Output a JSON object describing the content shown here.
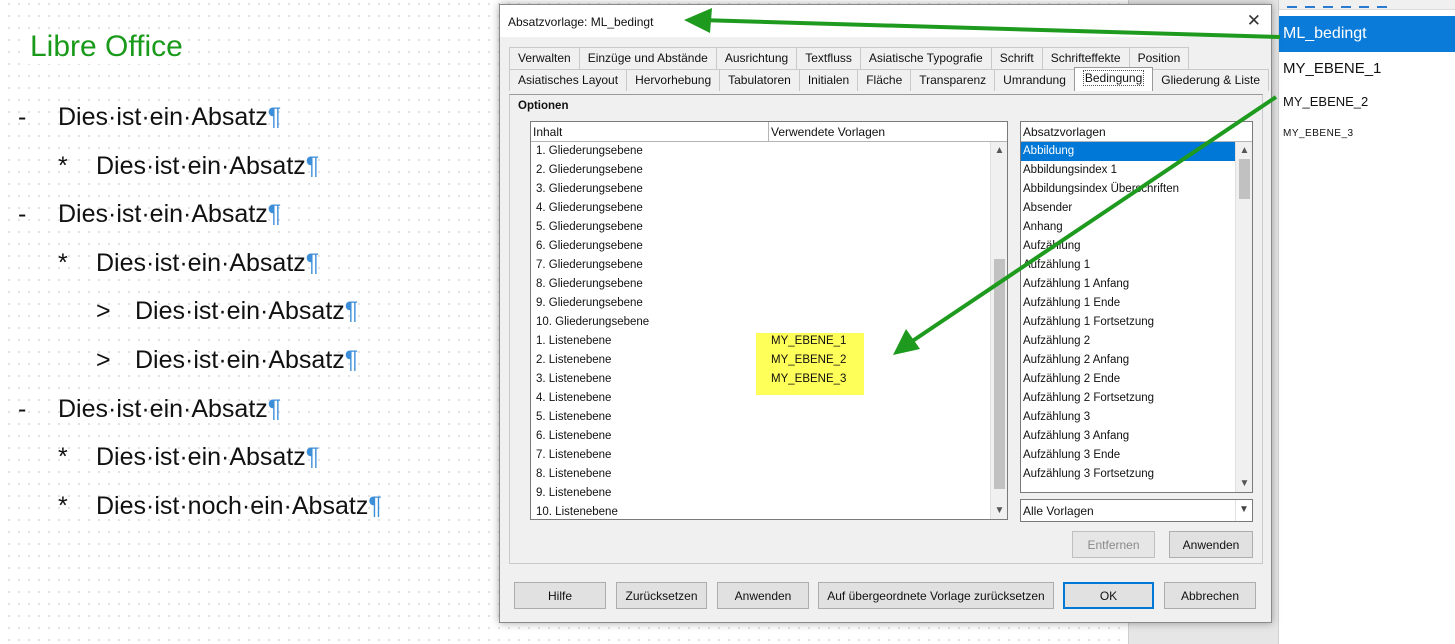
{
  "document": {
    "title": "Libre Office",
    "lines": [
      {
        "marker": "-",
        "text": "Dies·ist·ein·Absatz",
        "pilcrow": "¶"
      },
      {
        "marker": "*",
        "text": "Dies·ist·ein·Absatz",
        "pilcrow": "¶"
      },
      {
        "marker": "-",
        "text": "Dies·ist·ein·Absatz",
        "pilcrow": "¶"
      },
      {
        "marker": "*",
        "text": "Dies·ist·ein·Absatz",
        "pilcrow": "¶"
      },
      {
        "marker": ">",
        "text": "Dies·ist·ein·Absatz",
        "pilcrow": "¶"
      },
      {
        "marker": ">",
        "text": "Dies·ist·ein·Absatz",
        "pilcrow": "¶"
      },
      {
        "marker": "-",
        "text": "Dies·ist·ein·Absatz",
        "pilcrow": "¶"
      },
      {
        "marker": "*",
        "text": "Dies·ist·ein·Absatz",
        "pilcrow": "¶"
      },
      {
        "marker": "*",
        "text": "Dies·ist·noch·ein·Absatz",
        "pilcrow": "¶"
      }
    ]
  },
  "sidebar": {
    "items": [
      {
        "label": "ML_bedingt",
        "selected": true
      },
      {
        "label": "MY_EBENE_1",
        "selected": false
      },
      {
        "label": "MY_EBENE_2",
        "selected": false
      },
      {
        "label": "MY_EBENE_3",
        "selected": false
      }
    ]
  },
  "dialog": {
    "title": "Absatzvorlage: ML_bedingt",
    "close_glyph": "✕",
    "tabs_row1": [
      "Verwalten",
      "Einzüge und Abstände",
      "Ausrichtung",
      "Textfluss",
      "Asiatische Typografie",
      "Schrift",
      "Schrifteffekte",
      "Position"
    ],
    "tabs_row2": [
      "Asiatisches Layout",
      "Hervorhebung",
      "Tabulatoren",
      "Initialen",
      "Fläche",
      "Transparenz",
      "Umrandung",
      "Bedingung",
      "Gliederung & Liste"
    ],
    "active_tab": "Bedingung",
    "section_label": "Optionen",
    "grid": {
      "col1_header": "Inhalt",
      "col2_header": "Verwendete Vorlagen",
      "rows": [
        {
          "content": "1. Gliederungsebene",
          "style": ""
        },
        {
          "content": "2. Gliederungsebene",
          "style": ""
        },
        {
          "content": "3. Gliederungsebene",
          "style": ""
        },
        {
          "content": "4. Gliederungsebene",
          "style": ""
        },
        {
          "content": "5. Gliederungsebene",
          "style": ""
        },
        {
          "content": "6. Gliederungsebene",
          "style": ""
        },
        {
          "content": "7. Gliederungsebene",
          "style": ""
        },
        {
          "content": "8. Gliederungsebene",
          "style": ""
        },
        {
          "content": "9. Gliederungsebene",
          "style": ""
        },
        {
          "content": "10. Gliederungsebene",
          "style": ""
        },
        {
          "content": "1. Listenebene",
          "style": "MY_EBENE_1"
        },
        {
          "content": "2. Listenebene",
          "style": "MY_EBENE_2"
        },
        {
          "content": "3. Listenebene",
          "style": "MY_EBENE_3"
        },
        {
          "content": "4. Listenebene",
          "style": ""
        },
        {
          "content": "5. Listenebene",
          "style": ""
        },
        {
          "content": "6. Listenebene",
          "style": ""
        },
        {
          "content": "7. Listenebene",
          "style": ""
        },
        {
          "content": "8. Listenebene",
          "style": ""
        },
        {
          "content": "9. Listenebene",
          "style": ""
        },
        {
          "content": "10. Listenebene",
          "style": ""
        }
      ]
    },
    "styles_list": {
      "header": "Absatzvorlagen",
      "items": [
        "Abbildung",
        "Abbildungsindex 1",
        "Abbildungsindex Überschriften",
        "Absender",
        "Anhang",
        "Aufzählung",
        "Aufzählung 1",
        "Aufzählung 1 Anfang",
        "Aufzählung 1 Ende",
        "Aufzählung 1 Fortsetzung",
        "Aufzählung 2",
        "Aufzählung 2 Anfang",
        "Aufzählung 2 Ende",
        "Aufzählung 2 Fortsetzung",
        "Aufzählung 3",
        "Aufzählung 3 Anfang",
        "Aufzählung 3 Ende",
        "Aufzählung 3 Fortsetzung"
      ],
      "selected": "Abbildung"
    },
    "filter": {
      "value": "Alle Vorlagen"
    },
    "buttons": {
      "remove": "Entfernen",
      "apply_condition": "Anwenden",
      "help": "Hilfe",
      "reset": "Zurücksetzen",
      "apply": "Anwenden",
      "reset_parent": "Auf übergeordnete Vorlage zurücksetzen",
      "ok": "OK",
      "cancel": "Abbrechen"
    }
  },
  "colors": {
    "title_green": "#1a9a1a",
    "arrow_green": "#1e9a1e",
    "highlight_yellow": "#ffff5a",
    "selection_blue": "#0078d7",
    "pilcrow_blue": "#3c8ed8"
  },
  "icons": {
    "close": "close-icon",
    "scroll_up": "chevron-up-icon",
    "scroll_down": "chevron-down-icon",
    "dropdown": "chevron-down-icon"
  }
}
